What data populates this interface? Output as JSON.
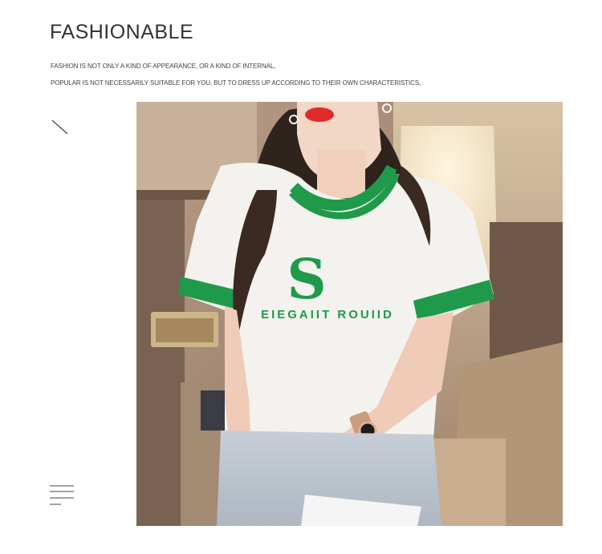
{
  "header": {
    "title": "FASHIONABLE",
    "line1": "FASHION IS NOT ONLY A KIND OF APPEARANCE, OR A KIND OF INTERNAL,",
    "line2": "POPULAR IS NOT NECESSARILY SUITABLE FOR YOU, BUT TO DRESS UP ACCORDING TO THEIR OWN CHARACTERISTICS,"
  },
  "icons": {
    "diagonal": "diagonal-line-icon",
    "menu": "menu-lines-icon"
  },
  "photo": {
    "shirt_letter": "S",
    "shirt_text": "EIEGAIIT ROUIID",
    "colors": {
      "accent_green": "#1f9a4a",
      "shirt": "#f3f2ef",
      "lips": "#e02a2a"
    }
  }
}
